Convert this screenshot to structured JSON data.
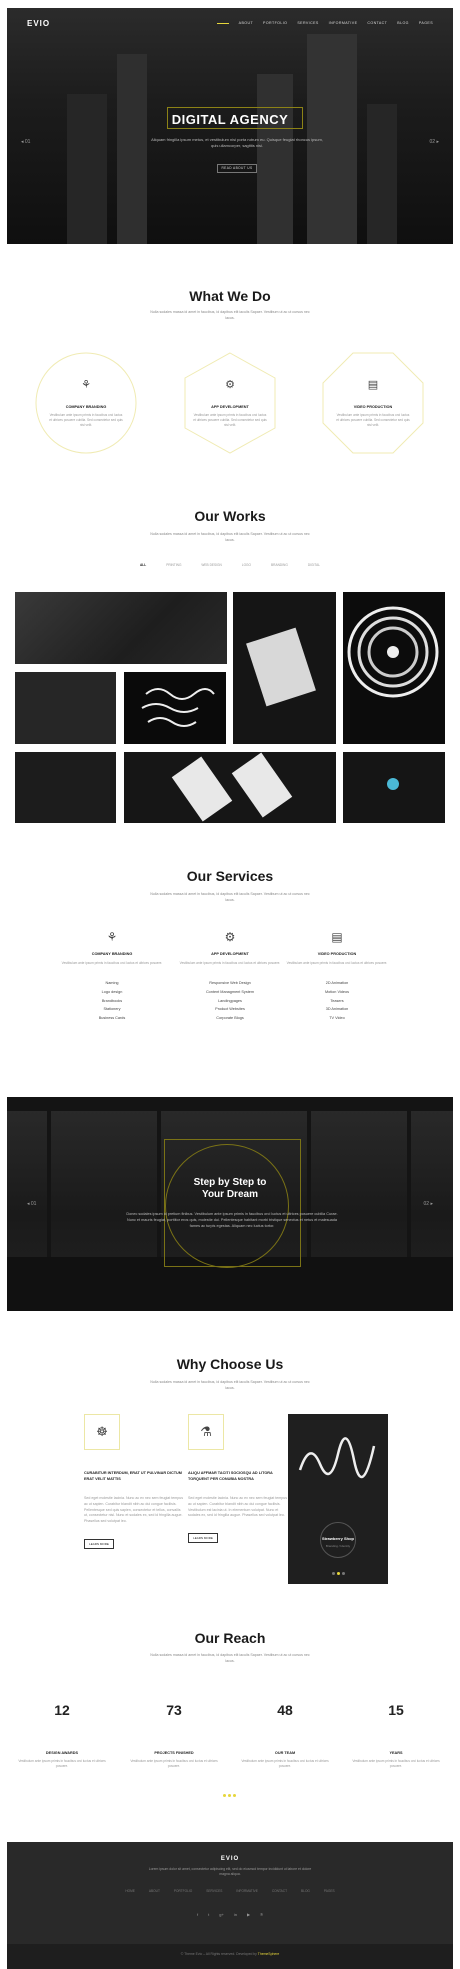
{
  "nav": {
    "logo": "EVIO",
    "items": [
      "ABOUT",
      "PORTFOLIO",
      "SERVICES",
      "INFORMATIVE",
      "CONTACT",
      "BLOG",
      "PAGES"
    ]
  },
  "hero": {
    "title": "DIGITAL AGENCY",
    "subtitle": "Aliquam fringilla ipsum metus, et vestibulum nisi porta rutrum eu. Quisque feugiat rhoncus ipsum, quis ullamcorper, sagittis nisi.",
    "button": "READ ABOUT US",
    "prev": "◂ 01",
    "next": "02 ▸"
  },
  "what_we_do": {
    "title": "What We Do",
    "subtitle": "Nulla sodales massa id amet in faucibus, id dapibus elit iaculis Sapaer. Vestibum ut ac ut cursus nec lacus.",
    "cards": [
      {
        "title": "COMPANY BRANDING",
        "text": "Vestibulum ante ipsum primis in faucibus orci luctus et ultrices posuere cubilia. Sed consectetur sed quis nisl velit.",
        "icon": "bicycle-icon"
      },
      {
        "title": "APP DEVELOPMENT",
        "text": "Vestibulum ante ipsum primis in faucibus orci luctus et ultrices posuere cubilia. Sed consectetur sed quis nisl velit.",
        "icon": "gears-icon"
      },
      {
        "title": "VIDEO PRODUCTION",
        "text": "Vestibulum ante ipsum primis in faucibus orci luctus et ultrices posuere cubilia. Sed consectetur sed quis nisl velit.",
        "icon": "video-icon"
      }
    ]
  },
  "works": {
    "title": "Our Works",
    "subtitle": "Nulla sodales massa id amet in faucibus, id dapibus elit iaculis Sapaer. Vestibum ut ac ut cursus nec lacus.",
    "filters": [
      "ALL",
      "PRINTING",
      "WEB DESIGN",
      "LOGO",
      "BRANDING",
      "DIGITAL"
    ]
  },
  "services": {
    "title": "Our Services",
    "subtitle": "Nulla sodales massa id amet in faucibus, id dapibus elit iaculis Sapaer. Vestibum ut ac ut cursus nec lacus.",
    "cols": [
      {
        "title": "COMPANY BRANDING",
        "text": "Vestibulum ante ipsum primis in faucibus orci luctus et ultrices posuere.",
        "icon": "bicycle-icon",
        "items": [
          "Naming",
          "Logo design",
          "Brandbooks",
          "Stationery",
          "Business Cards"
        ]
      },
      {
        "title": "APP DEVELOPMENT",
        "text": "Vestibulum ante ipsum primis in faucibus orci luctus et ultrices posuere.",
        "icon": "gears-icon",
        "items": [
          "Responsive Web Design",
          "Content Managment System",
          "Landingpages",
          "Product Websites",
          "Corporate Blogs"
        ]
      },
      {
        "title": "VIDEO PRODUCTION",
        "text": "Vestibulum ante ipsum primis in faucibus orci luctus et ultrices posuere.",
        "icon": "video-icon",
        "items": [
          "2D Animation",
          "Motion Videos",
          "Teasers",
          "3D Animation",
          "TV Video"
        ]
      }
    ]
  },
  "dream": {
    "title_line1": "Step by Step to",
    "title_line2": "Your Dream",
    "text": "Donec sodales ipsum id pretium finibus. Vestibulum ante ipsum primis in faucibus orci luctus et ultrices posuere cubilia Curae. Nunc et mauris feugiat, porttitor eros quis, molestie dui. Pellentesque habitant morbi tristique senectus et netus et malesuada fames ac turpis egestas. Aliquam nec luctus tortor.",
    "prev": "◂ 01",
    "next": "02 ▸"
  },
  "why": {
    "title": "Why Choose Us",
    "subtitle": "Nulla sodales massa id amet in faucibus, id dapibus elit iaculis Sapaer. Vestibum ut ac ut cursus nec lacus.",
    "cols": [
      {
        "title": "CURABITUR INTERDUM, ERAT UT PULVINAR DICTUM ERAT VELIT MATTIS",
        "text": "Sed eget molestie lacinia. Nunc ac ex nec sem feugiat tempus ac ut sapien. Curabitur blandit nibh ac dui congue facilisis. Pellentesque sed quis sapien, consectetur et tellus, convallis ut, consectetur nisl. Nunc et sodales ex, sed id fringilla augue. Phasellus sed volutpat leo.",
        "button": "LEARN MORE",
        "icon": "award-icon"
      },
      {
        "title": "ALIQU AFFMAR TACITI SOCIOSQU AD LITORA TORQUENT PER CONUBIA NOSTRA",
        "text": "Sed eget molestie lacinia. Nunc ac ex nec sem feugiat tempus ac ut sapien. Curabitur blandit nibh ac dui congue facilisis. Vestibulum est lacinia ut. In elementum volutpat. Nunc et sodales ex, sed id fringilla augue. Phasellus sed volutpat leo.",
        "button": "LEARN MORE",
        "icon": "flask-icon"
      }
    ],
    "phone_title": "Strawberry Shop",
    "phone_sub": "Branding / Identity"
  },
  "reach": {
    "title": "Our Reach",
    "subtitle": "Nulla sodales massa id amet in faucibus, id dapibus elit iaculis Sapaer. Vestibum ut ac ut cursus nec lacus.",
    "stats": [
      {
        "num": "12",
        "title": "DESIGN AWARDS",
        "text": "Vestibulum ante ipsum primis in faucibus orci luctus et ultrices posuere."
      },
      {
        "num": "73",
        "title": "PROJECTS FINISHED",
        "text": "Vestibulum ante ipsum primis in faucibus orci luctus et ultrices posuere."
      },
      {
        "num": "48",
        "title": "OUR TEAM",
        "text": "Vestibulum ante ipsum primis in faucibus orci luctus et ultrices posuere."
      },
      {
        "num": "15",
        "title": "YEARS",
        "text": "Vestibulum ante ipsum primis in faucibus orci luctus et ultrices posuere."
      }
    ]
  },
  "footer": {
    "logo": "EVIO",
    "text": "Lorem ipsum dolor sit amet, consectetur adipiscing elit, sed do eiusmod tempor incididunt ut labore et dolore magna aliqua.",
    "nav": [
      "HOME",
      "ABOUT",
      "PORTFOLIO",
      "SERVICES",
      "INFORMATIVE",
      "CONTACT",
      "BLOG",
      "PAGES"
    ],
    "social": [
      "f",
      "t",
      "g+",
      "in",
      "▶",
      "℗"
    ],
    "copy_pre": "© Theme Evio – All Rights reserved. Developed by",
    "copy_brand": "ThemeSphere"
  },
  "colors": {
    "accent": "#e6d63b",
    "dark": "#1c1c1c"
  }
}
